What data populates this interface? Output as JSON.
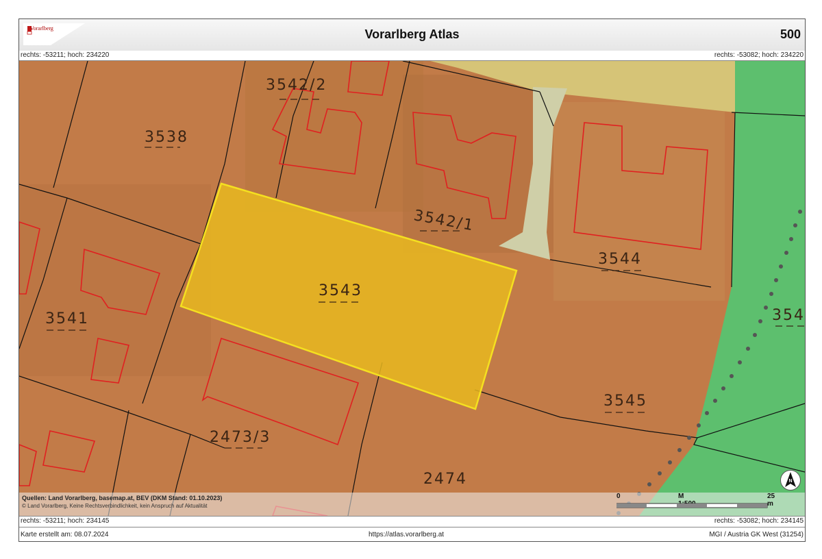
{
  "header": {
    "logo_text": "Vorarlberg",
    "title": "Vorarlberg Atlas",
    "scale_number": "500"
  },
  "coords": {
    "top_left": "rechts: -53211; hoch: 234220",
    "top_right": "rechts: -53082; hoch: 234220",
    "bottom_left": "rechts: -53211; hoch: 234145",
    "bottom_right": "rechts: -53082; hoch: 234145"
  },
  "map": {
    "parcels": {
      "p3538": "3538",
      "p3542_2": "3542/2",
      "p3542_1": "3542/1",
      "p3544": "3544",
      "p3543": "3543",
      "p3541": "3541",
      "p354x": "354",
      "p3545": "3545",
      "p2473_3": "2473/3",
      "p2474": "2474"
    },
    "highlight_color": "#e8b820",
    "forest_color": "#5dbf6e",
    "building_outline_color": "#e02020"
  },
  "credits": {
    "line1": "Quellen: Land Vorarlberg, basemap.at, BEV (DKM Stand: 01.10.2023)",
    "line2": "© Land Vorarlberg, Keine Rechtsverbindlichkeit, kein Anspruch auf Aktualität"
  },
  "scalebar": {
    "start": "0",
    "ratio": "M 1:500",
    "end": "25 m"
  },
  "north_arrow": "N",
  "footer": {
    "created": "Karte erstellt am: 08.07.2024",
    "url": "https://atlas.vorarlberg.at",
    "crs": "MGI / Austria GK West (31254)"
  }
}
